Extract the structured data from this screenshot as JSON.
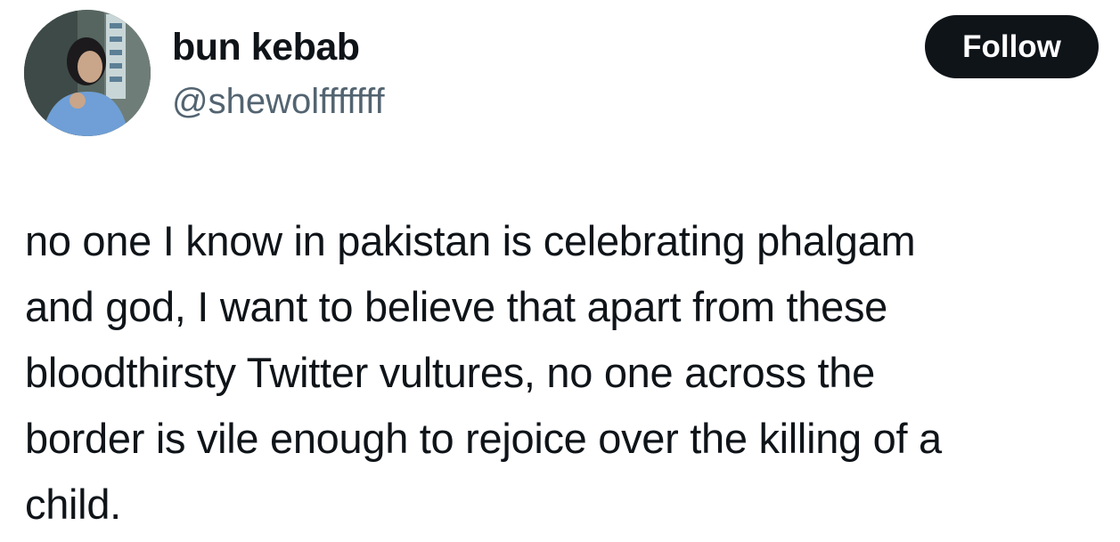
{
  "author": {
    "display_name": "bun kebab",
    "handle": "@shewolfffffff",
    "avatar_icon": "profile-photo"
  },
  "follow_button": {
    "label": "Follow"
  },
  "tweet": {
    "lines": [
      "no one I know in pakistan is celebrating phalgam",
      "and god, I want to believe that apart from these",
      "bloodthirsty Twitter vultures, no one across the",
      "border is vile enough to rejoice over the killing of a",
      "child."
    ]
  },
  "colors": {
    "text_primary": "#0f1419",
    "text_secondary": "#536471",
    "button_bg": "#0f1419",
    "button_text": "#ffffff",
    "background": "#ffffff"
  }
}
